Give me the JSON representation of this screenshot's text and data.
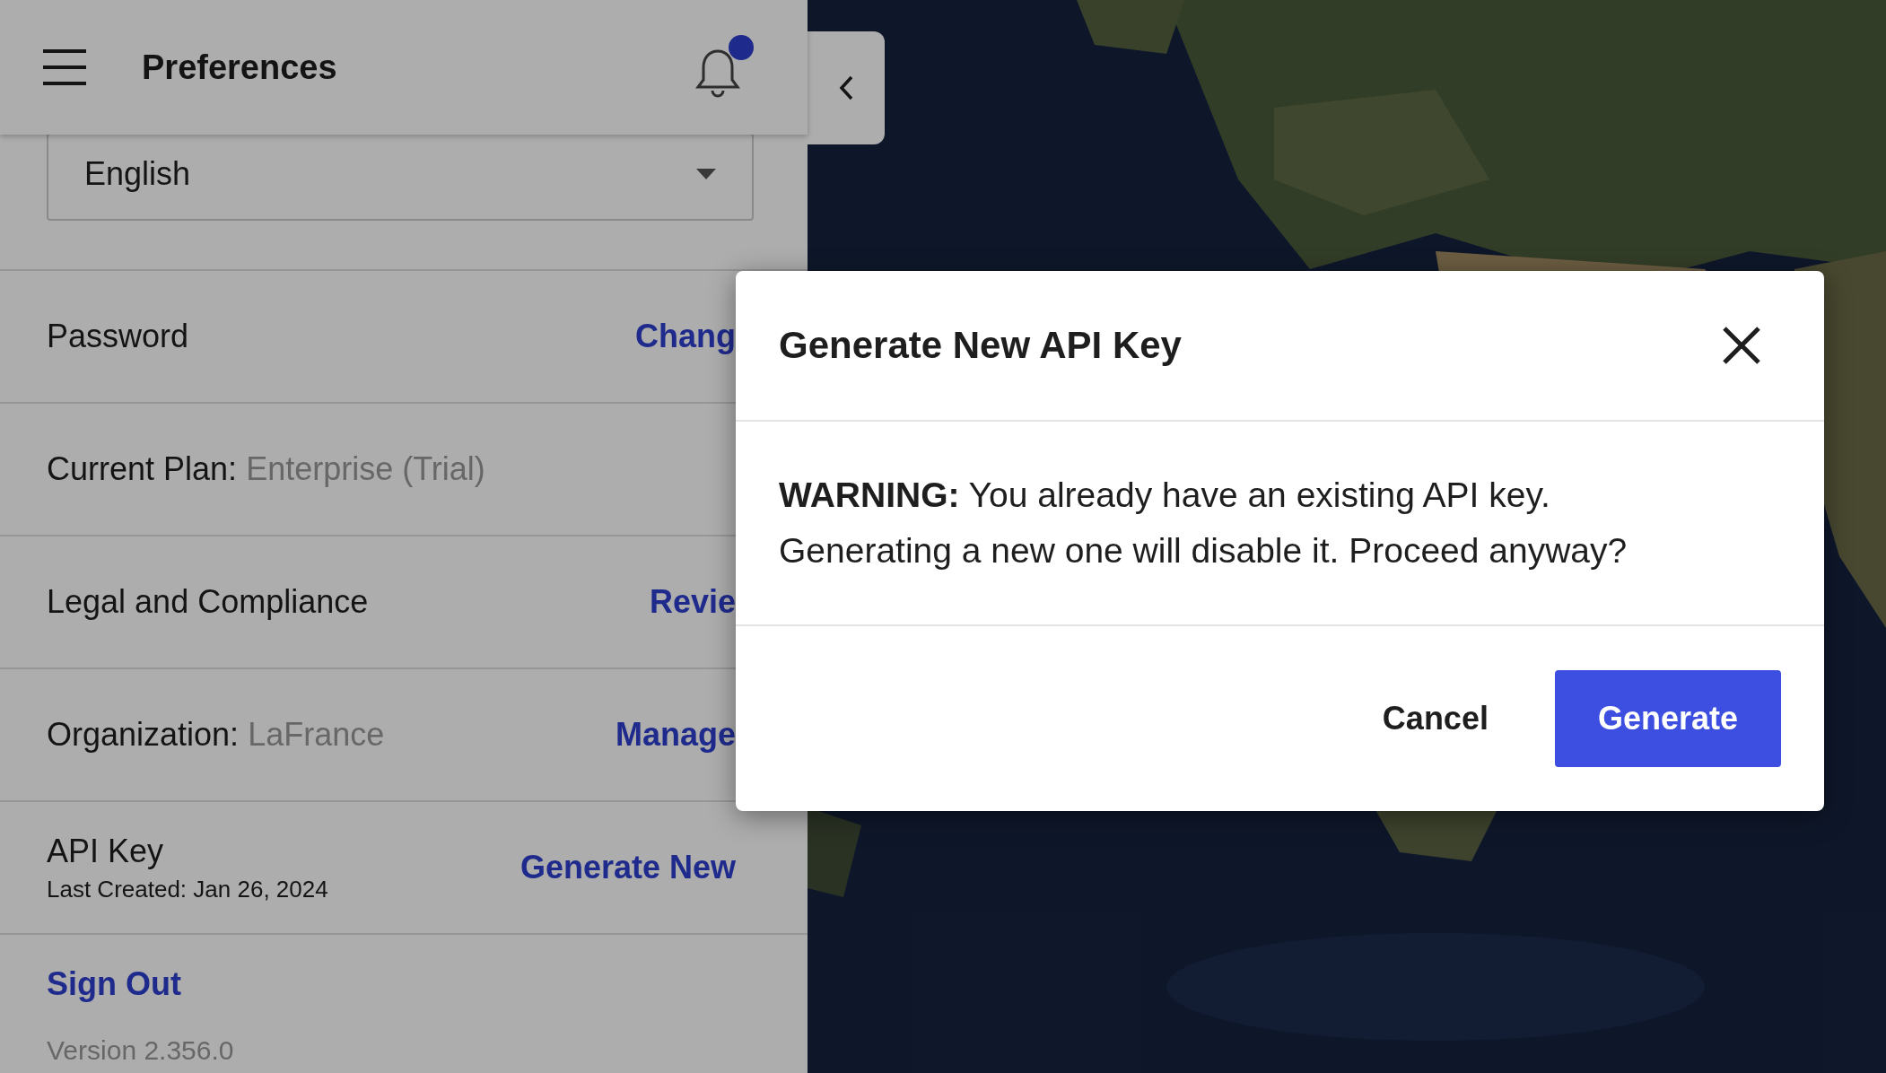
{
  "header": {
    "title": "Preferences",
    "notification_badge": true
  },
  "language": {
    "value": "English"
  },
  "rows": [
    {
      "kind": "action",
      "label": "Password",
      "action": "Chang"
    },
    {
      "kind": "info",
      "label": "Current Plan:",
      "value": "Enterprise (Trial)"
    },
    {
      "kind": "action",
      "label": "Legal and Compliance",
      "action": "Revie"
    },
    {
      "kind": "action",
      "label": "Organization:",
      "value": "LaFrance",
      "action": "Manage"
    },
    {
      "kind": "action",
      "label": "API Key",
      "subtitle": "Last Created: Jan 26, 2024",
      "action": "Generate New"
    }
  ],
  "sign_out": "Sign Out",
  "version": "Version 2.356.0",
  "dialog": {
    "title": "Generate New API Key",
    "message": "**WARNING:** You already have an existing API key. Generating a new one will disable it. Proceed anyway?",
    "buttons": [
      {
        "kind": "text",
        "label": "Cancel"
      },
      {
        "kind": "primary",
        "label": "Generate"
      }
    ]
  }
}
